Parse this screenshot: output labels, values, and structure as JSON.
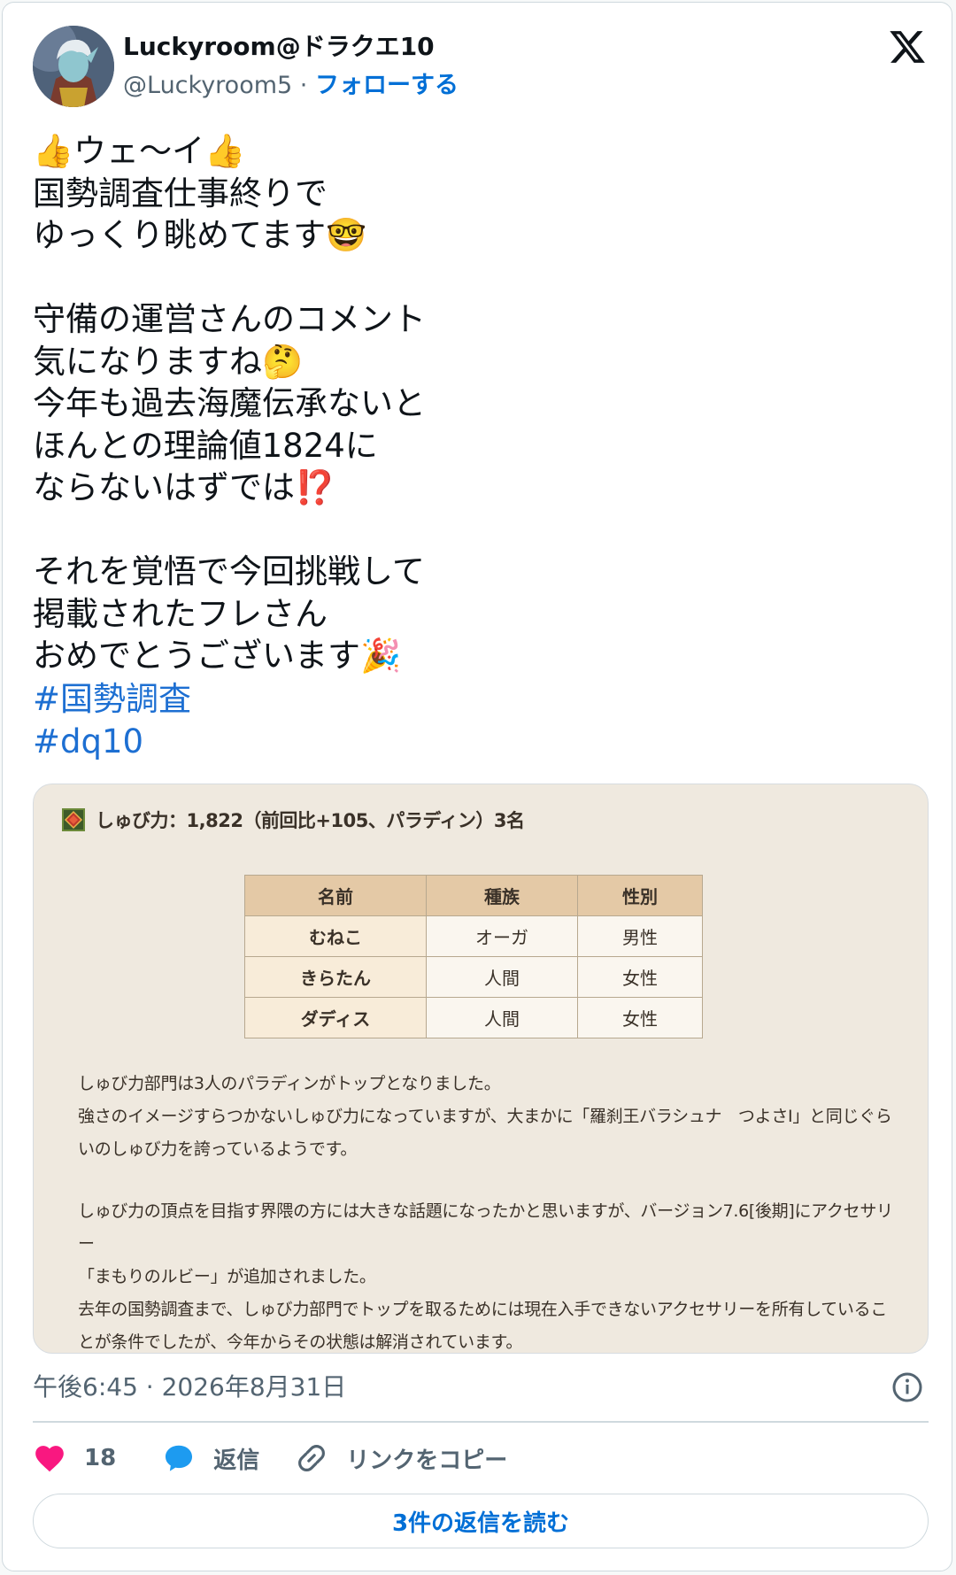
{
  "author": {
    "display_name": "Luckyroom@ドラクエ10",
    "handle": "@Luckyroom5",
    "separator": "·",
    "follow_label": "フォローする"
  },
  "tweet": {
    "text": "👍ウェ〜イ👍\n国勢調査仕事終りで\nゆっくり眺めてます🤓\n\n守備の運営さんのコメント\n気になりますね🤔\n今年も過去海魔伝承ないと\nほんとの理論値1824に\nならないはずでは⁉️\n\nそれを覚悟で今回挑戦して\n掲載されたフレさん\nおめでとうございます🎉",
    "hashtags": [
      "#国勢調査",
      "#dq10"
    ]
  },
  "media": {
    "heading": "しゅび力：1,822（前回比+105、パラディン）3名",
    "table": {
      "headers": [
        "名前",
        "種族",
        "性別"
      ],
      "rows": [
        [
          "むねこ",
          "オーガ",
          "男性"
        ],
        [
          "きらたん",
          "人間",
          "女性"
        ],
        [
          "ダディス",
          "人間",
          "女性"
        ]
      ]
    },
    "paragraph1": "しゅび力部門は3人のパラディンがトップとなりました。\n強さのイメージすらつかないしゅび力になっていますが、大まかに「羅刹王バラシュナ　つよさⅠ」と同じぐら\nいのしゅび力を誇っているようです。",
    "paragraph2": "しゅび力の頂点を目指す界隈の方には大きな話題になったかと思いますが、バージョン7.6[後期]にアクセサリー\n「まもりのルビー」が追加されました。\n去年の国勢調査まで、しゅび力部門でトップを取るためには現在入手できないアクセサリーを所有しているこ\nとが条件でしたが、今年からその状態は解消されています。"
  },
  "meta": {
    "timestamp": "午後6:45 · 2026年8月31日"
  },
  "actions": {
    "like_count": "18",
    "reply_label": "返信",
    "copy_link_label": "リンクをコピー"
  },
  "read_replies_label": "3件の返信を読む",
  "colors": {
    "accent": "#006fd6",
    "like": "#f91880",
    "reply_icon": "#1d9bf0"
  }
}
